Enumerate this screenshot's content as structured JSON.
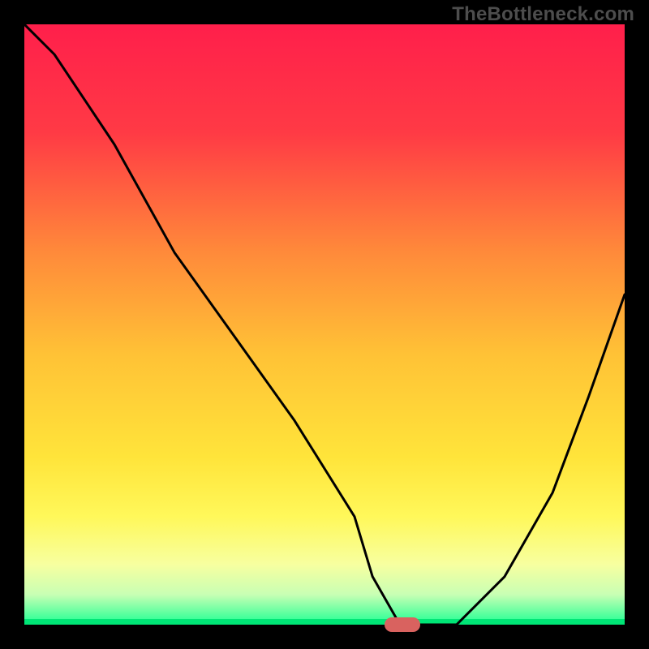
{
  "watermark": "TheBottleneck.com",
  "chart_data": {
    "type": "line",
    "title": "",
    "xlabel": "",
    "ylabel": "",
    "xlim": [
      0,
      100
    ],
    "ylim": [
      0,
      100
    ],
    "grid": false,
    "legend": false,
    "series": [
      {
        "name": "curve",
        "x": [
          0,
          5,
          15,
          25,
          35,
          45,
          55,
          58,
          62,
          65,
          72,
          80,
          88,
          94,
          100
        ],
        "y": [
          100,
          95,
          80,
          62,
          48,
          34,
          18,
          8,
          1,
          0,
          0,
          8,
          22,
          38,
          55
        ]
      }
    ],
    "marker": {
      "x": 63,
      "y": 0
    },
    "gradient_stops": [
      {
        "offset": 0,
        "color": "#ff1f4b"
      },
      {
        "offset": 18,
        "color": "#ff3a45"
      },
      {
        "offset": 38,
        "color": "#ff8a3a"
      },
      {
        "offset": 55,
        "color": "#ffc236"
      },
      {
        "offset": 72,
        "color": "#ffe43a"
      },
      {
        "offset": 82,
        "color": "#fff85a"
      },
      {
        "offset": 90,
        "color": "#f7ffa0"
      },
      {
        "offset": 95,
        "color": "#c8ffb4"
      },
      {
        "offset": 99,
        "color": "#3fff9a"
      },
      {
        "offset": 100,
        "color": "#00e676"
      }
    ]
  }
}
